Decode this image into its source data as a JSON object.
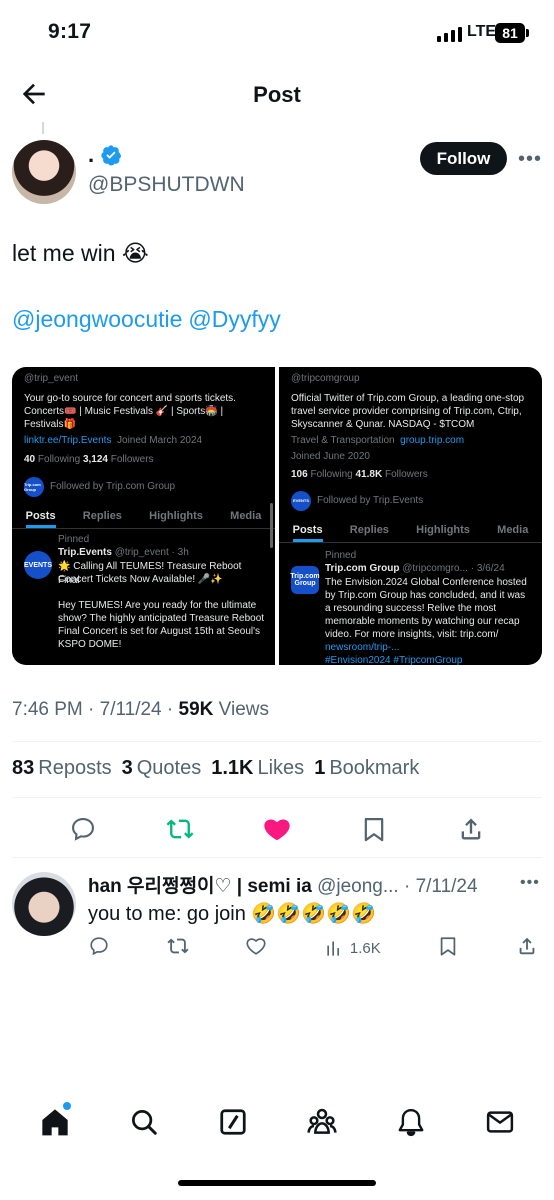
{
  "status_bar": {
    "time": "9:17",
    "network": "LTE",
    "battery": "81"
  },
  "header": {
    "title": "Post"
  },
  "author": {
    "name": ".",
    "handle": "@BPSHUTDWN",
    "follow_label": "Follow"
  },
  "post": {
    "text": "let me win 😭",
    "mentions": [
      "@jeongwoocutie",
      "@Dyyfyy"
    ],
    "timestamp": "7:46 PM · 7/11/24 · ",
    "views_count": "59K",
    "views_label": " Views"
  },
  "stats": [
    {
      "count": "83",
      "label": "Reposts"
    },
    {
      "count": "3",
      "label": "Quotes"
    },
    {
      "count": "1.1K",
      "label": "Likes"
    },
    {
      "count": "1",
      "label": "Bookmark"
    }
  ],
  "media": {
    "left": {
      "handle": "@trip_event",
      "bio_1": "Your go-to source for concert and sports tickets.",
      "bio_2": "Concerts🎟️ | Music Festivals 🎸 | Sports🏟️ |",
      "bio_3": "Festivals🎁",
      "link": "linktr.ee/Trip.Events",
      "joined": "Joined March 2024",
      "following": "40",
      "following_label": "Following",
      "followers": "3,124",
      "followers_label": "Followers",
      "followed_by": "Followed by Trip.com Group",
      "tabs": [
        "Posts",
        "Replies",
        "Highlights",
        "Media"
      ],
      "pinned": "Pinned",
      "tweet_name": "Trip.Events",
      "tweet_meta": "@trip_event · 3h",
      "tweet_1": "🌟 Calling All TEUMES! Treasure Reboot Final",
      "tweet_2": "Concert Tickets Now Available! 🎤✨",
      "tweet_3": "Hey TEUMES! Are you ready for the ultimate",
      "tweet_4": "show? The highly anticipated Treasure Reboot",
      "tweet_5": "Final Concert is set for August 15th at Seoul's",
      "tweet_6": "KSPO DOME!",
      "logo_text": "Trip.com Group",
      "events_logo": "EVENTS"
    },
    "right": {
      "handle": "@tripcomgroup",
      "bio_1": "Official Twitter of Trip.com Group, a leading one-stop",
      "bio_2": "travel service provider comprising of Trip.com, Ctrip,",
      "bio_3": "Skyscanner & Qunar. NASDAQ - $TCOM",
      "category": "Travel & Transportation",
      "link": "group.trip.com",
      "joined": "Joined June 2020",
      "following": "106",
      "following_label": "Following",
      "followers": "41.8K",
      "followers_label": "Followers",
      "followed_by": "Followed by Trip.Events",
      "tabs": [
        "Posts",
        "Replies",
        "Highlights",
        "Media"
      ],
      "pinned": "Pinned",
      "tweet_name": "Trip.com Group",
      "tweet_meta": "@tripcomgro... · 3/6/24",
      "tweet_1": "The Envision.2024 Global Conference hosted",
      "tweet_2": "by Trip.com Group has concluded, and it was",
      "tweet_3": "a resounding success! Relive the most",
      "tweet_4": "memorable moments by watching our recap",
      "tweet_5": "video. For more insights, visit: trip.com/",
      "tweet_6": "newsroom/trip-...",
      "tweet_7": "#Envision2024 #TripcomGroup",
      "logo_text": "Trip.com Group",
      "events_logo": "EVENTS"
    }
  },
  "reply": {
    "name": "han 우리쩡쩡이♡ | semi ia",
    "meta": " @jeong... · 7/11/24",
    "text": "you to me: go join 🤣🤣🤣🤣🤣",
    "views": "1.6K"
  },
  "colors": {
    "accent": "#1d9bf0",
    "repost": "#00ba7c",
    "like": "#f91880"
  }
}
